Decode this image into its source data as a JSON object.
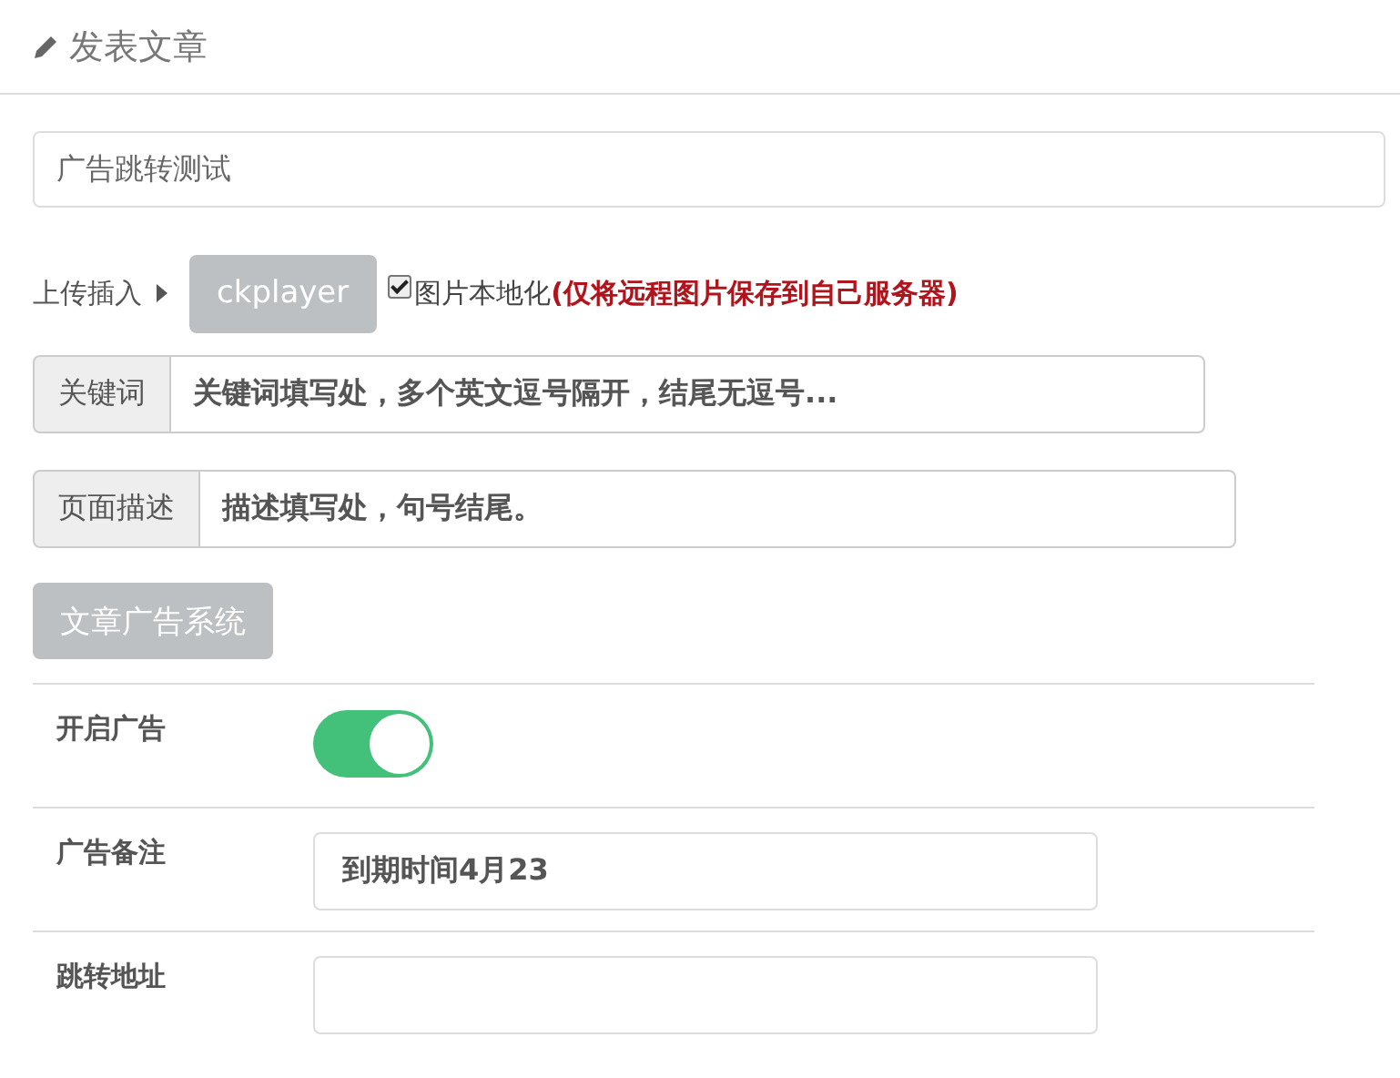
{
  "header": {
    "title": "发表文章"
  },
  "title_field": {
    "value": "广告跳转测试"
  },
  "upload": {
    "label": "上传插入",
    "button": "ckplayer",
    "localize": {
      "label": "图片本地化",
      "checked": true
    },
    "note": "(仅将远程图片保存到自己服务器)"
  },
  "keywords": {
    "label": "关键词",
    "value": "关键词填写处，多个英文逗号隔开，结尾无逗号..."
  },
  "description": {
    "label": "页面描述",
    "value": "描述填写处，句号结尾。"
  },
  "ad_button": "文章广告系统",
  "ad_settings": [
    {
      "kind": "toggle",
      "label": "开启广告",
      "on": true
    },
    {
      "kind": "text",
      "label": "广告备注",
      "value": "到期时间4月23"
    },
    {
      "kind": "text",
      "label": "跳转地址"
    }
  ]
}
